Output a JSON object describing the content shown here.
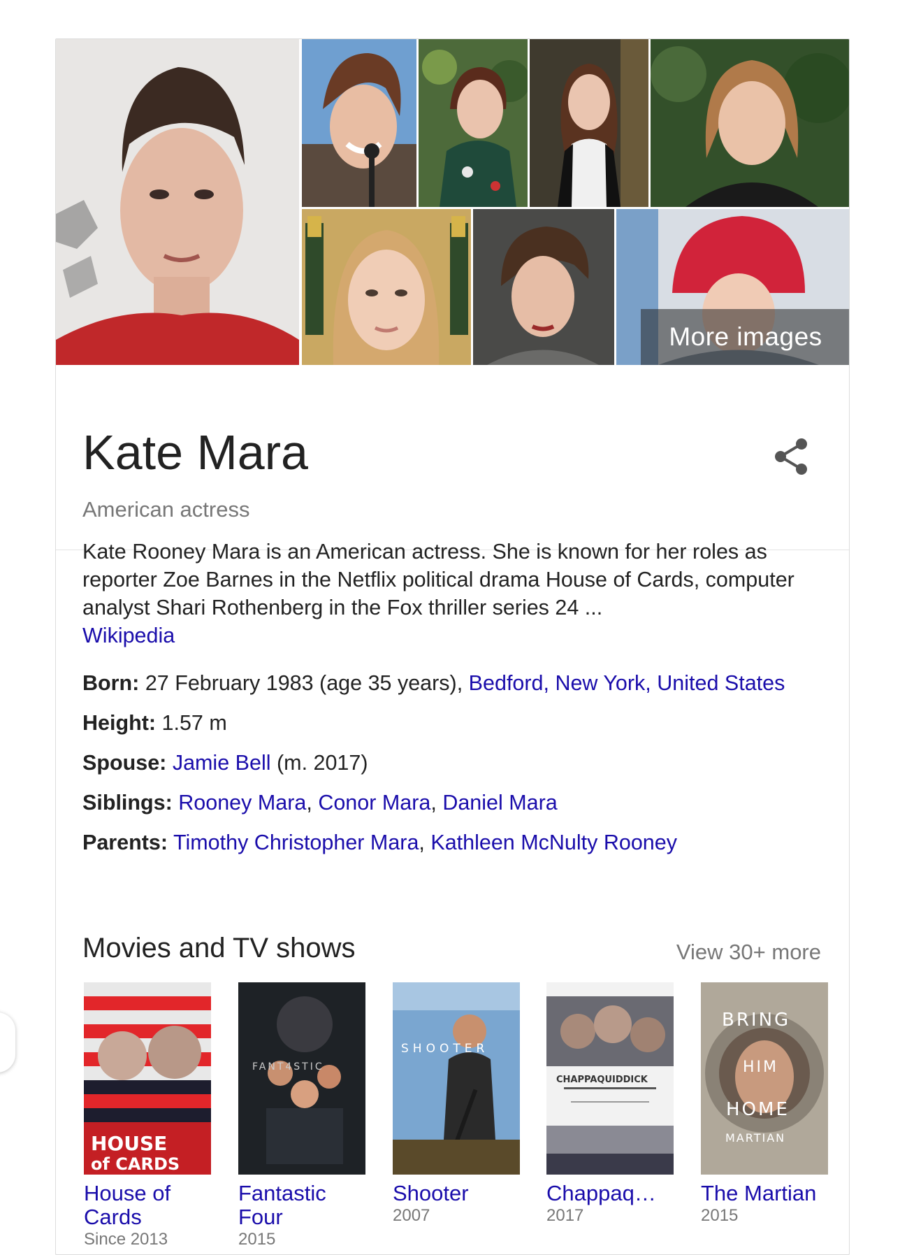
{
  "gallery": {
    "more_images_label": "More images"
  },
  "entity": {
    "name": "Kate Mara",
    "subtitle": "American actress",
    "share_icon": "share-icon"
  },
  "description": {
    "text": "Kate Rooney Mara is an American actress. She is known for her roles as reporter Zoe Barnes in the Netflix political drama House of Cards, computer analyst Shari Rothenberg in the Fox thriller series 24 ...",
    "source": "Wikipedia"
  },
  "facts": {
    "born": {
      "label": "Born:",
      "text": "27 February 1983 (age 35 years), ",
      "link": "Bedford, New York, United States"
    },
    "height": {
      "label": "Height:",
      "text": "1.57 m"
    },
    "spouse": {
      "label": "Spouse:",
      "link": "Jamie Bell",
      "text": "(m. 2017)"
    },
    "siblings": {
      "label": "Siblings:",
      "links": [
        "Rooney Mara",
        "Conor Mara",
        "Daniel Mara"
      ],
      "sep": ", "
    },
    "parents": {
      "label": "Parents:",
      "links": [
        "Timothy Christopher Mara",
        "Kathleen McNulty Rooney"
      ],
      "sep": ", "
    }
  },
  "movies": {
    "heading": "Movies and TV shows",
    "view_more": "View 30+ more",
    "items": [
      {
        "title_line1": "House of",
        "title_line2": "Cards",
        "year": "Since 2013",
        "poster_text": [
          "HOUSE",
          "of CARDS"
        ]
      },
      {
        "title_line1": "Fantastic",
        "title_line2": "Four",
        "year": "2015",
        "poster_text": [
          "FANT4STIC"
        ]
      },
      {
        "title_line1": "Shooter",
        "title_line2": "",
        "year": "2007",
        "poster_text": [
          "SHOOTER"
        ]
      },
      {
        "title_line1": "Chappaq…",
        "title_line2": "",
        "year": "2017",
        "poster_text": [
          "CHAPPAQUIDDICK"
        ]
      },
      {
        "title_line1": "The Martian",
        "title_line2": "",
        "year": "2015",
        "poster_text": [
          "BRING",
          "HIM",
          "HOME",
          "MARTIAN"
        ]
      }
    ]
  },
  "colors": {
    "link": "#1a0dab",
    "muted": "#777777",
    "text": "#222222"
  }
}
